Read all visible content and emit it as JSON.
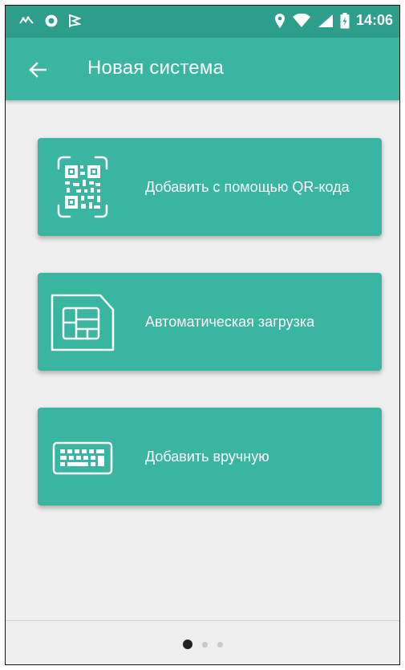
{
  "status_bar": {
    "time": "14:06",
    "icons_left": [
      "app-notification-icon",
      "circle-icon",
      "flag-icon"
    ],
    "icons_right": [
      "location-icon",
      "wifi-icon",
      "signal-icon",
      "battery-icon"
    ]
  },
  "app_bar": {
    "title": "Новая система",
    "back_icon": "arrow-left-icon"
  },
  "options": [
    {
      "label": "Добавить с помощью QR-кода",
      "icon": "qr-code-icon"
    },
    {
      "label": "Автоматическая загрузка",
      "icon": "sim-card-icon"
    },
    {
      "label": "Добавить вручную",
      "icon": "keyboard-icon"
    }
  ],
  "pager": {
    "pages": 3,
    "current": 1
  },
  "colors": {
    "status_bar": "#2e9e8c",
    "app_bar": "#39b5a1",
    "card": "#39b5a1",
    "background": "#eeeeee"
  }
}
